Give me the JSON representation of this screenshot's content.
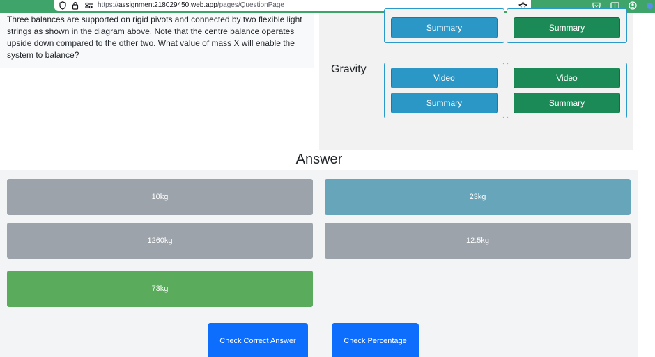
{
  "browser": {
    "url_scheme": "https://",
    "url_host": "assignment218029450.web.app",
    "url_path": "/pages/QuestionPage",
    "icons": [
      "shield-icon",
      "lock-icon",
      "permissions-icon",
      "bookmark-star-icon",
      "pocket-icon",
      "reader-view-icon",
      "account-icon",
      "extension-icon"
    ],
    "bar_color": "#3fa46a"
  },
  "question": {
    "text": "Three balances are supported on rigid pivots and connected by two flexible light strings as shown in the diagram above. Note that the centre balance operates upside down compared to the other two. What value of mass X will enable the system to balance?"
  },
  "resources": {
    "top_row": {
      "left_label": "Summary",
      "right_label": "Summary"
    },
    "gravity": {
      "label": "Gravity",
      "left_video": "Video",
      "left_summary": "Summary",
      "right_video": "Video",
      "right_summary": "Summary"
    },
    "colors": {
      "blue": "#2a97c6",
      "green": "#1c8a57",
      "border": "#2c9ac9"
    }
  },
  "answer": {
    "heading": "Answer",
    "options": [
      "10kg",
      "23kg",
      "1260kg",
      "12.5kg",
      "73kg"
    ],
    "colors": {
      "neutral": "#9ca3aa",
      "highlight": "#67a5bb",
      "correct": "#5bab5c"
    },
    "check_correct_label": "Check Correct Answer",
    "check_percentage_label": "Check Percentage",
    "action_color": "#0d6efd"
  }
}
